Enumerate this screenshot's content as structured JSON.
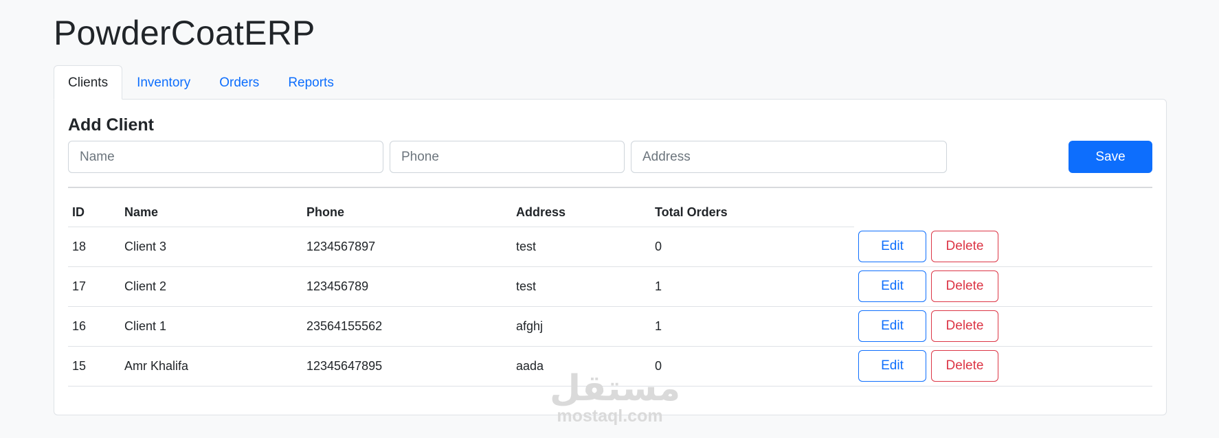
{
  "app": {
    "title": "PowderCoatERP"
  },
  "tabs": [
    {
      "label": "Clients",
      "active": true
    },
    {
      "label": "Inventory",
      "active": false
    },
    {
      "label": "Orders",
      "active": false
    },
    {
      "label": "Reports",
      "active": false
    }
  ],
  "add_client": {
    "title": "Add Client",
    "name_placeholder": "Name",
    "phone_placeholder": "Phone",
    "address_placeholder": "Address",
    "name_value": "",
    "phone_value": "",
    "address_value": "",
    "save_label": "Save"
  },
  "table": {
    "headers": {
      "id": "ID",
      "name": "Name",
      "phone": "Phone",
      "address": "Address",
      "total_orders": "Total Orders"
    },
    "edit_label": "Edit",
    "delete_label": "Delete",
    "rows": [
      {
        "id": "18",
        "name": "Client 3",
        "phone": "1234567897",
        "address": "test",
        "total_orders": "0"
      },
      {
        "id": "17",
        "name": "Client 2",
        "phone": "123456789",
        "address": "test",
        "total_orders": "1"
      },
      {
        "id": "16",
        "name": "Client 1",
        "phone": "23564155562",
        "address": "afghj",
        "total_orders": "1"
      },
      {
        "id": "15",
        "name": "Amr Khalifa",
        "phone": "12345647895",
        "address": "aada",
        "total_orders": "0"
      }
    ]
  },
  "watermark": {
    "arabic": "مستقل",
    "latin": "mostaql.com"
  },
  "colors": {
    "primary": "#0d6efd",
    "danger": "#dc3545",
    "background": "#f8f9fa"
  }
}
